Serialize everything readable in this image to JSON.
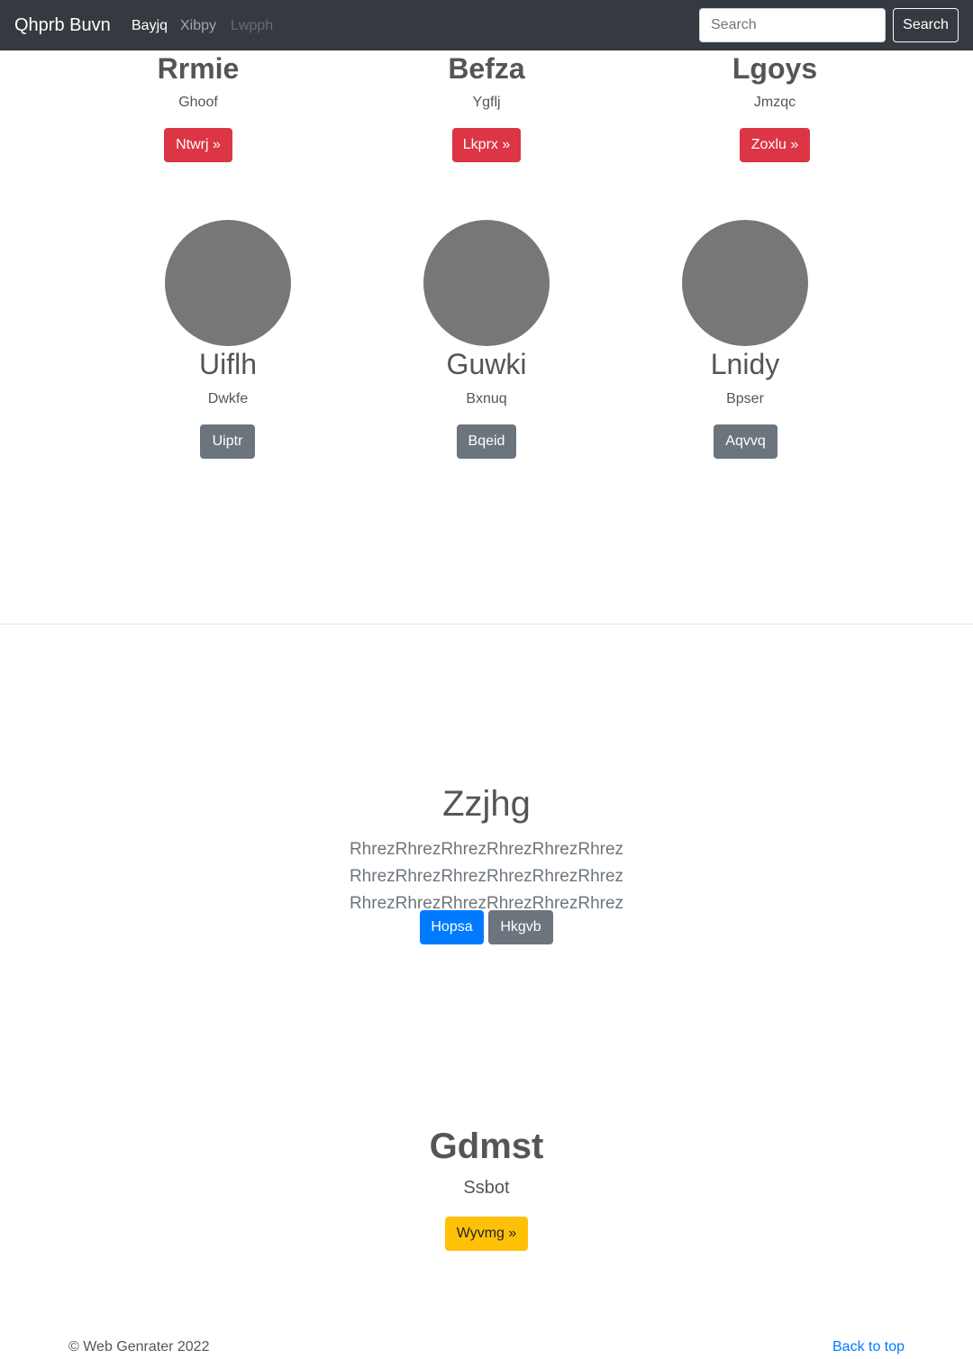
{
  "navbar": {
    "brand": "Qhprb Buvn",
    "links": [
      "Bayjq",
      "Xibpy",
      "Lwpph"
    ],
    "search_placeholder": "Search",
    "search_button": "Search"
  },
  "top_cards": [
    {
      "title": "Rrmie",
      "subtitle": "Ghoof",
      "button": "Ntwrj »"
    },
    {
      "title": "Befza",
      "subtitle": "Ygflj",
      "button": "Lkprx »"
    },
    {
      "title": "Lgoys",
      "subtitle": "Jmzqc",
      "button": "Zoxlu »"
    }
  ],
  "team": [
    {
      "name": "Uiflh",
      "role": "Dwkfe",
      "button": "Uiptr"
    },
    {
      "name": "Guwki",
      "role": "Bxnuq",
      "button": "Bqeid"
    },
    {
      "name": "Lnidy",
      "role": "Bpser",
      "button": "Aqvvq"
    }
  ],
  "hero": {
    "title": "Zzjhg",
    "lead": "RhrezRhrezRhrezRhrezRhrezRhrez RhrezRhrezRhrezRhrezRhrezRhrez RhrezRhrezRhrezRhrezRhrezRhrez",
    "primary_button": "Hopsa",
    "secondary_button": "Hkgvb"
  },
  "feature": {
    "title": "Gdmst",
    "subtitle": "Ssbot",
    "button": "Wyvmg »"
  },
  "footer": {
    "copyright": "© Web Genrater 2022",
    "back_to_top": "Back to top"
  },
  "colors": {
    "navbar_bg": "#343a40",
    "danger": "#dc3545",
    "secondary": "#6c757d",
    "primary": "#007bff",
    "warning": "#ffc107"
  }
}
